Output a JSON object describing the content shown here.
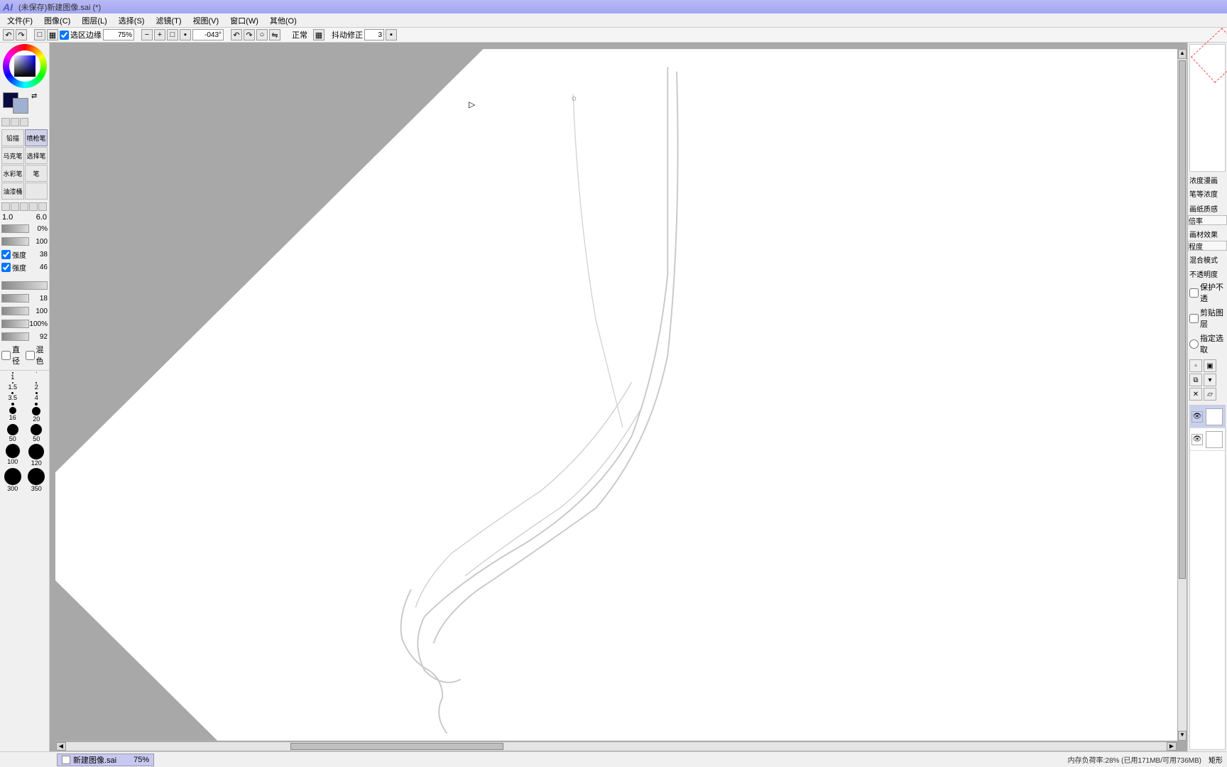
{
  "title": "(未保存)新建图像.sai (*)",
  "logo_text": "AI",
  "menu": [
    "文件(F)",
    "图像(C)",
    "图层(L)",
    "选择(S)",
    "滤镜(T)",
    "视图(V)",
    "窗口(W)",
    "其他(O)"
  ],
  "toolbar": {
    "selection_edge": "选区边缘",
    "zoom": "75%",
    "rotation": "-043°",
    "mode": "正常",
    "stabilizer_label": "抖动修正",
    "stabilizer": "3"
  },
  "left": {
    "tools": [
      "铅描",
      "喷枪笔",
      "马克笔",
      "选择笔",
      "水彩笔",
      "笔",
      "油漆桶",
      ""
    ],
    "brush_min": "1.0",
    "brush_max": "6.0",
    "pct0": "0%",
    "s1_val": "100",
    "s2_label": "强度",
    "s2_val": "38",
    "s3_label": "强度",
    "s3_val": "46",
    "s4_val": "18",
    "s5_val": "100",
    "s6_val": "100%",
    "s7_val": "92",
    "diameter_label": "直径",
    "blending_label": "混色",
    "presets": [
      {
        "size": "1",
        "d": 2
      },
      {
        "size": "",
        "d": 1
      },
      {
        "size": "1.5",
        "d": 2
      },
      {
        "size": "2",
        "d": 2
      },
      {
        "size": "3.5",
        "d": 3
      },
      {
        "size": "4",
        "d": 3
      },
      {
        "size": "",
        "d": 4
      },
      {
        "size": "",
        "d": 4
      },
      {
        "size": "16",
        "d": 10
      },
      {
        "size": "20",
        "d": 12
      },
      {
        "size": "50",
        "d": 16
      },
      {
        "size": "50",
        "d": 16
      },
      {
        "size": "100",
        "d": 20
      },
      {
        "size": "120",
        "d": 22
      },
      {
        "size": "300",
        "d": 24
      },
      {
        "size": "350",
        "d": 24
      }
    ]
  },
  "right": {
    "nav1": "浓度漫画",
    "nav2": "笔等浓度",
    "paper_texture": "画纸质感",
    "paper_texture_val": "倍率",
    "material_effect": "画材效果",
    "material_effect_val": "程度",
    "blend_mode_label": "混合模式",
    "opacity_label": "不透明度",
    "protect_alpha": "保护不透",
    "clip_layer": "剪贴图层",
    "select_source": "指定选取"
  },
  "footer": {
    "doc_name": "新建图像.sai",
    "doc_zoom": "75%",
    "mem_status": "内存负荷率:28% (已用171MB/可用736MB)",
    "rect_label": "矩形"
  }
}
